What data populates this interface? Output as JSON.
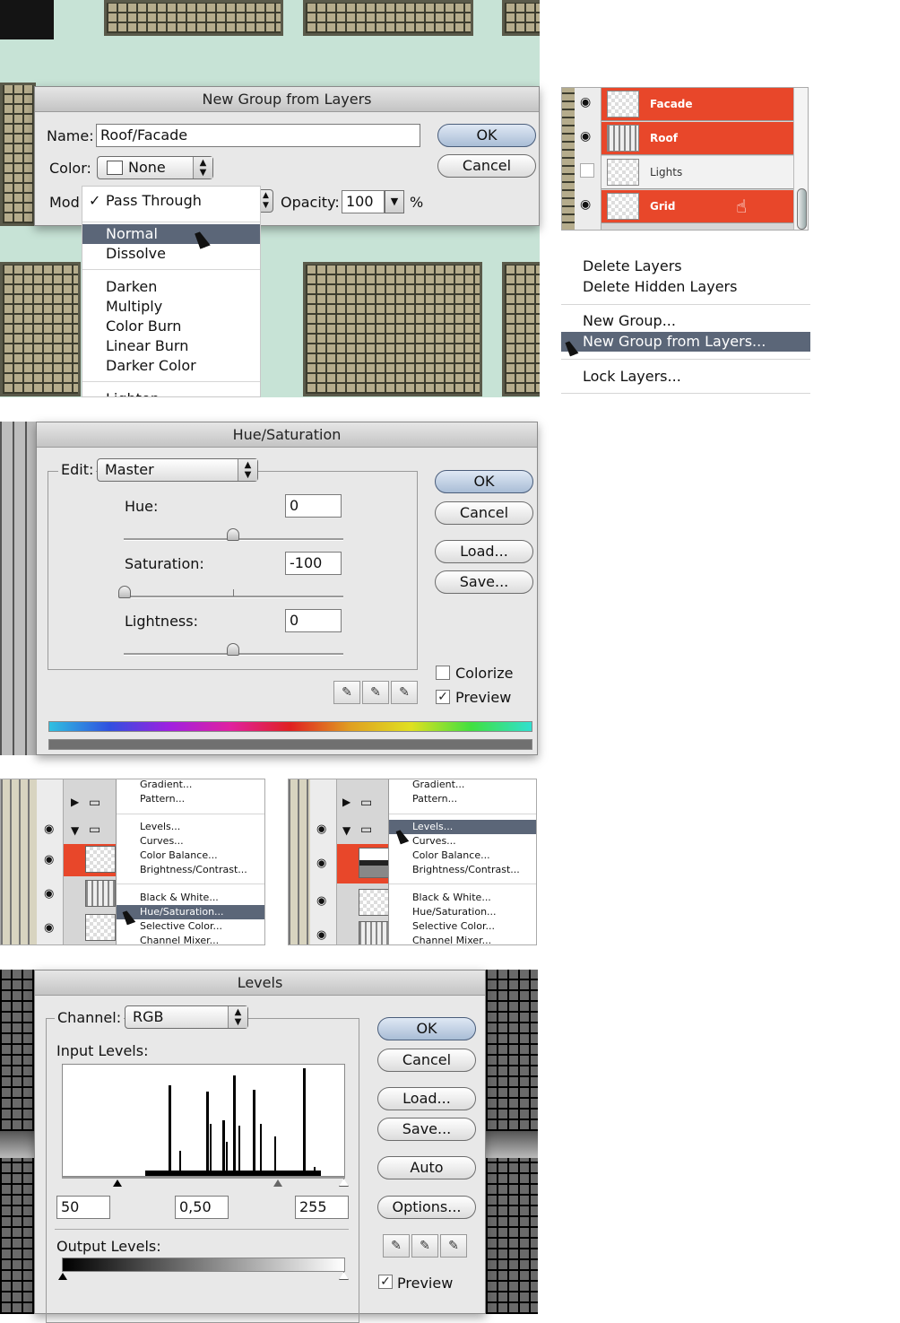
{
  "new_group": {
    "title": "New Group from Layers",
    "name_label": "Name:",
    "name_value": "Roof/Facade",
    "color_label": "Color:",
    "color_value": "None",
    "mode_label": "Mod",
    "opacity_label": "Opacity:",
    "opacity_value": "100",
    "opacity_unit": "%",
    "ok": "OK",
    "cancel": "Cancel",
    "blend_menu": {
      "checked": "✓",
      "items": [
        "Pass Through",
        "Normal",
        "Dissolve",
        "Darken",
        "Multiply",
        "Color Burn",
        "Linear Burn",
        "Darker Color",
        "Lighten"
      ],
      "selected": "Normal"
    }
  },
  "layers_panel": {
    "rows": [
      {
        "name": "Facade",
        "visible": true,
        "selected": true
      },
      {
        "name": "Roof",
        "visible": true,
        "selected": true
      },
      {
        "name": "Lights",
        "visible": false,
        "selected": false
      },
      {
        "name": "Grid",
        "visible": true,
        "selected": true
      }
    ],
    "context_menu": [
      "Delete Layers",
      "Delete Hidden Layers",
      "New Group...",
      "New Group from Layers...",
      "Lock Layers..."
    ],
    "context_selected": "New Group from Layers...",
    "accent": "#e8472a"
  },
  "hue_sat": {
    "title": "Hue/Saturation",
    "edit_label": "Edit:",
    "edit_value": "Master",
    "hue_label": "Hue:",
    "hue_value": "0",
    "sat_label": "Saturation:",
    "sat_value": "-100",
    "light_label": "Lightness:",
    "light_value": "0",
    "ok": "OK",
    "cancel": "Cancel",
    "load": "Load...",
    "save": "Save...",
    "colorize": "Colorize",
    "preview": "Preview"
  },
  "adjust_menu_left": {
    "items": [
      "Gradient...",
      "Pattern...",
      "Levels...",
      "Curves...",
      "Color Balance...",
      "Brightness/Contrast...",
      "Black & White...",
      "Hue/Saturation...",
      "Selective Color...",
      "Channel Mixer..."
    ],
    "selected": "Hue/Saturation..."
  },
  "adjust_menu_right": {
    "items": [
      "Gradient...",
      "Pattern...",
      "Levels...",
      "Curves...",
      "Color Balance...",
      "Brightness/Contrast...",
      "Black & White...",
      "Hue/Saturation...",
      "Selective Color...",
      "Channel Mixer..."
    ],
    "selected": "Levels..."
  },
  "levels": {
    "title": "Levels",
    "channel_label": "Channel:",
    "channel_value": "RGB",
    "input_label": "Input Levels:",
    "in_black": "50",
    "in_gamma": "0,50",
    "in_white": "255",
    "output_label": "Output Levels:",
    "ok": "OK",
    "cancel": "Cancel",
    "load": "Load...",
    "save": "Save...",
    "auto": "Auto",
    "options": "Options...",
    "preview": "Preview"
  }
}
